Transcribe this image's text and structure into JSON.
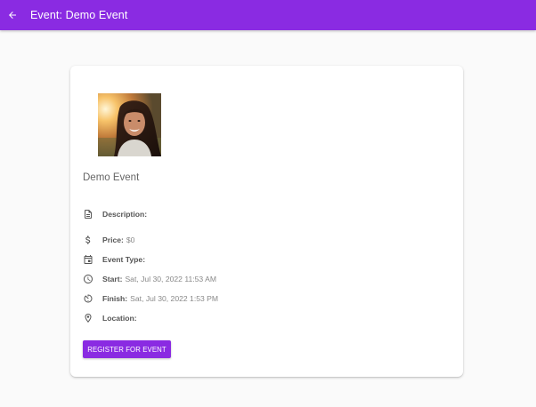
{
  "appbar": {
    "back_icon": "arrow-left-icon",
    "title": "Event: Demo Event",
    "color": "#8a2be2"
  },
  "event": {
    "photo_alt": "event-photo",
    "name": "Demo Event",
    "fields": [
      {
        "icon": "document-icon",
        "label": "Description:",
        "value": ""
      },
      {
        "icon": "dollar-icon",
        "label": "Price:",
        "value": "$0"
      },
      {
        "icon": "calendar-icon",
        "label": "Event Type:",
        "value": ""
      },
      {
        "icon": "clock-icon",
        "label": "Start:",
        "value": "Sat, Jul 30, 2022 11:53 AM"
      },
      {
        "icon": "timer-icon",
        "label": "Finish:",
        "value": "Sat, Jul 30, 2022 1:53 PM"
      },
      {
        "icon": "location-pin-icon",
        "label": "Location:",
        "value": ""
      }
    ],
    "register_label": "REGISTER FOR EVENT"
  }
}
